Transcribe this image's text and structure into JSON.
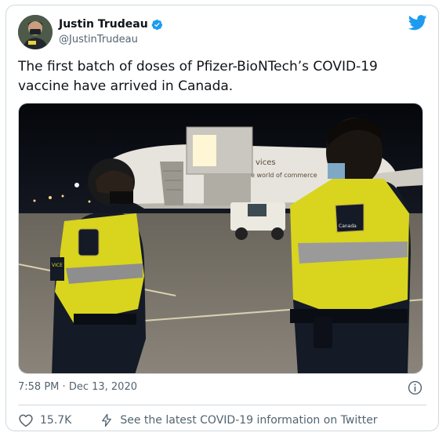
{
  "author": {
    "display_name": "Justin Trudeau",
    "handle": "@JustinTrudeau",
    "verified_icon": "verified-badge-icon",
    "avatar_icon": "avatar"
  },
  "platform_icon": "twitter-bird-icon",
  "tweet": {
    "text": "The first batch of doses of Pfizer-BioNTech’s COVID-19 vaccine have arrived in Canada.",
    "image": {
      "plane_text_1": "vices",
      "plane_text_2": "e world of commerce",
      "vest_badge_text": "Canada",
      "vest_side_text": "VICE TAURIN"
    }
  },
  "meta": {
    "time": "7:58 PM",
    "separator": "·",
    "date": "Dec 13, 2020"
  },
  "actions": {
    "like_count": "15.7K",
    "covid_info_label": "See the latest COVID-19 information on Twitter"
  },
  "colors": {
    "accent": "#1d9bf0",
    "text": "#0f1419",
    "secondary": "#536471",
    "border": "#cfd9de",
    "vest_yellow": "#d9d41e"
  }
}
